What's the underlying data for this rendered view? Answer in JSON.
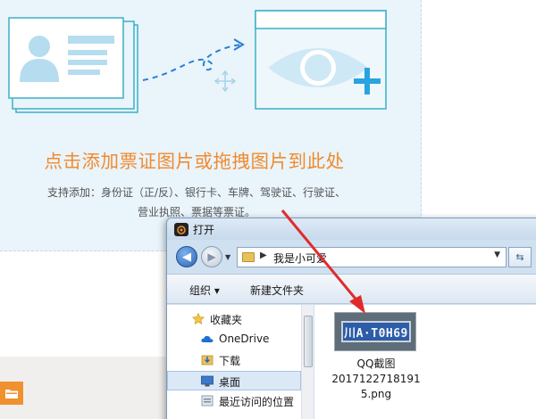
{
  "upload": {
    "headline": "点击添加票证图片或拖拽图片到此处",
    "subtext_line1": "支持添加：身份证（正/反）、银行卡、车牌、驾驶证、行驶证、",
    "subtext_line2": "营业执照、票据等票证。"
  },
  "dialog": {
    "title": "打开",
    "address_path": "我是小可爱",
    "toolbar": {
      "organize": "组织 ▾",
      "new_folder": "新建文件夹"
    },
    "nav_items": [
      {
        "label": "收藏夹",
        "icon": "star-icon"
      },
      {
        "label": "OneDrive",
        "icon": "cloud-icon"
      },
      {
        "label": "下载",
        "icon": "download-folder-icon"
      },
      {
        "label": "桌面",
        "icon": "desktop-icon"
      },
      {
        "label": "最近访问的位置",
        "icon": "recent-places-icon"
      }
    ],
    "file": {
      "plate_text": "川A·T0H69",
      "name_line1": "QQ截图",
      "name_line2": "2017122718191",
      "name_line3": "5.png"
    }
  },
  "colors": {
    "accent_orange": "#f28a2e",
    "drop_zone_bg": "#e9f4fb",
    "arrow_red": "#e02b2b"
  }
}
